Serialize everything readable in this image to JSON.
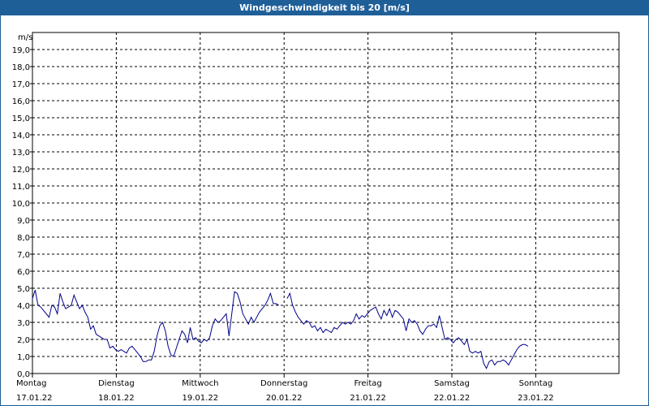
{
  "window": {
    "title": "Windgeschwindigkeit bis 20 [m/s]"
  },
  "colors": {
    "titlebar": "#1f5f98",
    "series": "#00008b",
    "grid": "#000000"
  },
  "chart_data": {
    "type": "line",
    "title": "Windgeschwindigkeit bis 20 [m/s]",
    "ylabel": "m/s",
    "ylim": [
      0,
      20
    ],
    "yticks": [
      "0,0",
      "1,0",
      "2,0",
      "3,0",
      "4,0",
      "5,0",
      "6,0",
      "7,0",
      "8,0",
      "9,0",
      "10,0",
      "11,0",
      "12,0",
      "13,0",
      "14,0",
      "15,0",
      "16,0",
      "17,0",
      "18,0",
      "19,0"
    ],
    "xlim": [
      0,
      7
    ],
    "days": [
      {
        "day": "Montag",
        "date": "17.01.22"
      },
      {
        "day": "Dienstag",
        "date": "18.01.22"
      },
      {
        "day": "Mittwoch",
        "date": "19.01.22"
      },
      {
        "day": "Donnerstag",
        "date": "20.01.22"
      },
      {
        "day": "Freitag",
        "date": "21.01.22"
      },
      {
        "day": "Samstag",
        "date": "22.01.22"
      },
      {
        "day": "Sonntag",
        "date": "23.01.22"
      }
    ],
    "grid": true,
    "series": [
      {
        "segments": [
          [
            [
              0.0,
              4.4
            ],
            [
              0.033,
              4.9
            ],
            [
              0.066,
              4.0
            ],
            [
              0.099,
              3.9
            ],
            [
              0.132,
              3.7
            ],
            [
              0.165,
              3.5
            ],
            [
              0.198,
              3.3
            ],
            [
              0.231,
              4.0
            ],
            [
              0.264,
              3.9
            ],
            [
              0.297,
              3.5
            ],
            [
              0.33,
              4.7
            ],
            [
              0.363,
              4.2
            ],
            [
              0.396,
              3.8
            ],
            [
              0.429,
              3.9
            ],
            [
              0.462,
              4.0
            ],
            [
              0.495,
              4.6
            ],
            [
              0.528,
              4.2
            ],
            [
              0.561,
              3.8
            ],
            [
              0.594,
              4.0
            ],
            [
              0.627,
              3.6
            ],
            [
              0.66,
              3.3
            ],
            [
              0.693,
              2.6
            ],
            [
              0.726,
              2.8
            ],
            [
              0.759,
              2.3
            ],
            [
              0.792,
              2.2
            ],
            [
              0.825,
              2.1
            ],
            [
              0.858,
              2.0
            ],
            [
              0.891,
              2.0
            ],
            [
              0.924,
              1.5
            ],
            [
              0.957,
              1.6
            ],
            [
              0.99,
              1.4
            ],
            [
              1.023,
              1.3
            ],
            [
              1.056,
              1.4
            ],
            [
              1.089,
              1.3
            ],
            [
              1.122,
              1.2
            ],
            [
              1.155,
              1.5
            ],
            [
              1.188,
              1.6
            ],
            [
              1.221,
              1.4
            ],
            [
              1.254,
              1.2
            ],
            [
              1.287,
              1.0
            ],
            [
              1.32,
              0.7
            ],
            [
              1.353,
              0.7
            ],
            [
              1.386,
              0.8
            ],
            [
              1.419,
              0.8
            ],
            [
              1.452,
              1.3
            ],
            [
              1.485,
              2.2
            ],
            [
              1.518,
              2.8
            ],
            [
              1.551,
              3.0
            ],
            [
              1.584,
              2.5
            ],
            [
              1.617,
              1.6
            ],
            [
              1.65,
              1.1
            ],
            [
              1.683,
              1.0
            ],
            [
              1.716,
              1.5
            ],
            [
              1.749,
              2.0
            ],
            [
              1.782,
              2.5
            ],
            [
              1.815,
              2.3
            ],
            [
              1.848,
              1.8
            ],
            [
              1.881,
              2.7
            ],
            [
              1.914,
              2.0
            ],
            [
              1.947,
              2.1
            ],
            [
              1.98,
              1.9
            ],
            [
              2.013,
              1.8
            ],
            [
              2.046,
              2.0
            ],
            [
              2.079,
              1.9
            ],
            [
              2.112,
              2.1
            ],
            [
              2.145,
              2.8
            ],
            [
              2.178,
              3.2
            ],
            [
              2.211,
              3.0
            ],
            [
              2.244,
              3.1
            ],
            [
              2.277,
              3.3
            ],
            [
              2.31,
              3.5
            ],
            [
              2.343,
              2.2
            ],
            [
              2.376,
              3.5
            ],
            [
              2.409,
              4.8
            ],
            [
              2.442,
              4.7
            ],
            [
              2.475,
              4.2
            ],
            [
              2.508,
              3.5
            ],
            [
              2.541,
              3.2
            ],
            [
              2.574,
              2.9
            ],
            [
              2.607,
              3.3
            ],
            [
              2.64,
              3.0
            ],
            [
              2.673,
              3.3
            ],
            [
              2.706,
              3.6
            ],
            [
              2.739,
              3.8
            ],
            [
              2.772,
              4.0
            ],
            [
              2.805,
              4.3
            ],
            [
              2.838,
              4.7
            ],
            [
              2.871,
              4.1
            ],
            [
              2.904,
              4.1
            ],
            [
              2.937,
              4.0
            ]
          ],
          [
            [
              3.036,
              4.4
            ],
            [
              3.069,
              4.7
            ],
            [
              3.102,
              4.0
            ],
            [
              3.135,
              3.6
            ],
            [
              3.168,
              3.3
            ],
            [
              3.201,
              3.1
            ],
            [
              3.234,
              2.9
            ],
            [
              3.267,
              3.1
            ],
            [
              3.3,
              3.0
            ],
            [
              3.333,
              2.7
            ],
            [
              3.366,
              2.8
            ],
            [
              3.399,
              2.5
            ],
            [
              3.432,
              2.7
            ],
            [
              3.465,
              2.4
            ],
            [
              3.498,
              2.6
            ],
            [
              3.531,
              2.5
            ],
            [
              3.564,
              2.4
            ],
            [
              3.597,
              2.7
            ],
            [
              3.63,
              2.6
            ],
            [
              3.663,
              2.8
            ],
            [
              3.696,
              3.0
            ],
            [
              3.729,
              2.9
            ],
            [
              3.762,
              3.0
            ],
            [
              3.795,
              2.9
            ],
            [
              3.828,
              3.1
            ],
            [
              3.861,
              3.5
            ],
            [
              3.894,
              3.2
            ],
            [
              3.927,
              3.4
            ],
            [
              3.96,
              3.3
            ],
            [
              3.993,
              3.5
            ],
            [
              4.026,
              3.7
            ],
            [
              4.059,
              3.8
            ],
            [
              4.092,
              3.9
            ],
            [
              4.125,
              3.5
            ],
            [
              4.158,
              3.2
            ],
            [
              4.191,
              3.7
            ],
            [
              4.224,
              3.4
            ],
            [
              4.257,
              3.8
            ],
            [
              4.29,
              3.3
            ],
            [
              4.323,
              3.7
            ],
            [
              4.356,
              3.6
            ],
            [
              4.389,
              3.4
            ],
            [
              4.422,
              3.2
            ],
            [
              4.455,
              2.5
            ],
            [
              4.488,
              3.2
            ],
            [
              4.521,
              3.0
            ],
            [
              4.554,
              3.1
            ],
            [
              4.587,
              2.9
            ],
            [
              4.62,
              2.5
            ],
            [
              4.653,
              2.3
            ],
            [
              4.686,
              2.6
            ],
            [
              4.719,
              2.8
            ],
            [
              4.752,
              2.8
            ],
            [
              4.785,
              2.9
            ],
            [
              4.818,
              2.7
            ],
            [
              4.851,
              3.4
            ],
            [
              4.884,
              2.7
            ],
            [
              4.917,
              2.0
            ],
            [
              4.95,
              2.1
            ],
            [
              4.983,
              2.0
            ],
            [
              5.016,
              1.8
            ],
            [
              5.049,
              2.0
            ],
            [
              5.082,
              2.1
            ],
            [
              5.115,
              1.9
            ],
            [
              5.148,
              1.7
            ],
            [
              5.181,
              2.0
            ],
            [
              5.214,
              1.3
            ],
            [
              5.247,
              1.2
            ],
            [
              5.28,
              1.3
            ],
            [
              5.313,
              1.2
            ],
            [
              5.346,
              1.3
            ],
            [
              5.379,
              0.6
            ],
            [
              5.412,
              0.3
            ],
            [
              5.445,
              0.7
            ],
            [
              5.478,
              0.8
            ],
            [
              5.511,
              0.5
            ],
            [
              5.544,
              0.7
            ],
            [
              5.577,
              0.7
            ],
            [
              5.61,
              0.8
            ],
            [
              5.643,
              0.7
            ],
            [
              5.676,
              0.5
            ],
            [
              5.709,
              0.8
            ],
            [
              5.742,
              1.1
            ],
            [
              5.775,
              1.4
            ],
            [
              5.808,
              1.6
            ],
            [
              5.841,
              1.7
            ],
            [
              5.874,
              1.7
            ],
            [
              5.907,
              1.6
            ]
          ]
        ]
      }
    ]
  }
}
